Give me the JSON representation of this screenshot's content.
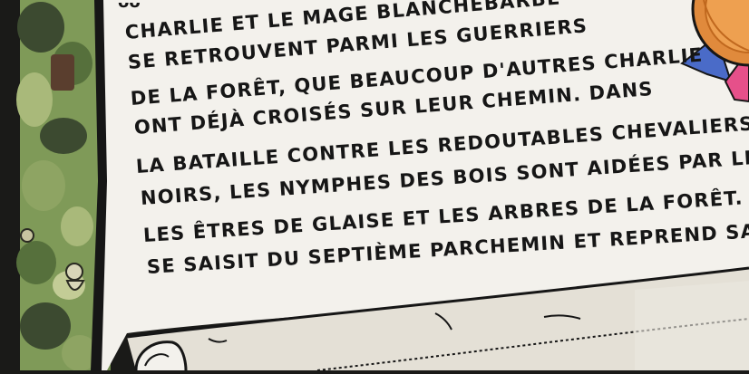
{
  "illustration": {
    "colors": {
      "left_edge": "#1a1a18",
      "forest_dark": "#3c4a30",
      "forest_mid": "#6f8a4c",
      "forest_light": "#a9b97a",
      "parchment": "#f3f1ec",
      "parchment_shadow": "#e4e0d6",
      "ink": "#161616",
      "rosette_orange": "#e08a3c",
      "rosette_pink": "#e6508a",
      "ribbon_blue": "#4a6bc8"
    },
    "icons": [
      "forest-illustration",
      "rosette-badge",
      "scroll-roll"
    ]
  },
  "text_lines": [
    "CHARLIE ET LE MAGE BLANCHEBARBE",
    "SE RETROUVENT PARMI LES GUERRIERS",
    "DE LA FORÊT, QUE BEAUCOUP D'AUTRES CHARLIE",
    "ONT DÉJÀ CROISÉS SUR LEUR CHEMIN. DANS",
    "LA BATAILLE CONTRE LES REDOUTABLES CHEVALIERS",
    "NOIRS, LES NYMPHES DES BOIS SONT AIDÉES PAR LES AN",
    "LES ÊTRES DE GLAISE ET LES ARBRES DE LA FORÊT. CHA",
    "SE SAISIT DU SEPTIÈME PARCHEMIN ET REPREND SA RO"
  ]
}
